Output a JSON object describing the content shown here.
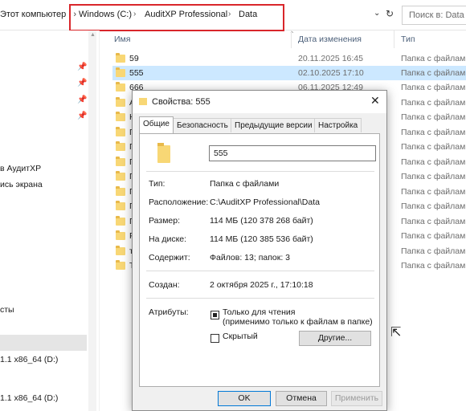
{
  "address": {
    "left_text": "Этот компьютер",
    "crumbs": [
      "Windows (C:)",
      "AuditXP Professional",
      "Data"
    ],
    "search_placeholder": "Поиск в: Data"
  },
  "nav": {
    "items": [
      "в АудитХР",
      "ись экрана",
      "сты",
      "1.1 x86_64 (D:)",
      "1.1 x86_64 (D:)"
    ]
  },
  "list": {
    "columns": {
      "name": "Имя",
      "date": "Дата изменения",
      "type": "Тип"
    },
    "rows": [
      {
        "name": "59",
        "date": "20.11.2025 16:45",
        "type": "Папка с файлами"
      },
      {
        "name": "555",
        "date": "02.10.2025 17:10",
        "type": "Папка с файлами",
        "selected": true
      },
      {
        "name": "666",
        "date": "06.11.2025 12:49",
        "type": "Папка с файлами"
      },
      {
        "name": "А",
        "date": "",
        "type": "Папка с файлами"
      },
      {
        "name": "Н",
        "date": "",
        "type": "Папка с файлами"
      },
      {
        "name": "П",
        "date": "",
        "type": "Папка с файлами"
      },
      {
        "name": "П",
        "date": "",
        "type": "Папка с файлами"
      },
      {
        "name": "П",
        "date": "",
        "type": "Папка с файлами"
      },
      {
        "name": "П",
        "date": "",
        "type": "Папка с файлами"
      },
      {
        "name": "П",
        "date": "",
        "type": "Папка с файлами"
      },
      {
        "name": "П",
        "date": "",
        "type": "Папка с файлами"
      },
      {
        "name": "П",
        "date": "",
        "type": "Папка с файлами"
      },
      {
        "name": "Р",
        "date": "",
        "type": "Папка с файлами"
      },
      {
        "name": "т",
        "date": "",
        "type": "Папка с файлами"
      },
      {
        "name": "Т",
        "date": "",
        "type": "Папка с файлами"
      }
    ]
  },
  "dialog": {
    "title": "Свойства: 555",
    "tabs": [
      "Общие",
      "Безопасность",
      "Предыдущие версии",
      "Настройка"
    ],
    "folder_name": "555",
    "props": [
      {
        "label": "Тип:",
        "value": "Папка с файлами"
      },
      {
        "label": "Расположение:",
        "value": "C:\\AuditXP Professional\\Data"
      },
      {
        "label": "Размер:",
        "value": "114 МБ (120 378 268 байт)"
      },
      {
        "label": "На диске:",
        "value": "114 МБ (120 385 536 байт)"
      },
      {
        "label": "Содержит:",
        "value": "Файлов: 13; папок: 3"
      }
    ],
    "created_label": "Создан:",
    "created_value": "2 октября 2025 г., 17:10:18",
    "attributes_label": "Атрибуты:",
    "readonly_label": "Только для чтения",
    "readonly_note": "(применимо только к файлам в папке)",
    "hidden_label": "Скрытый",
    "other_button": "Другие...",
    "ok": "OK",
    "cancel": "Отмена",
    "apply": "Применить"
  }
}
